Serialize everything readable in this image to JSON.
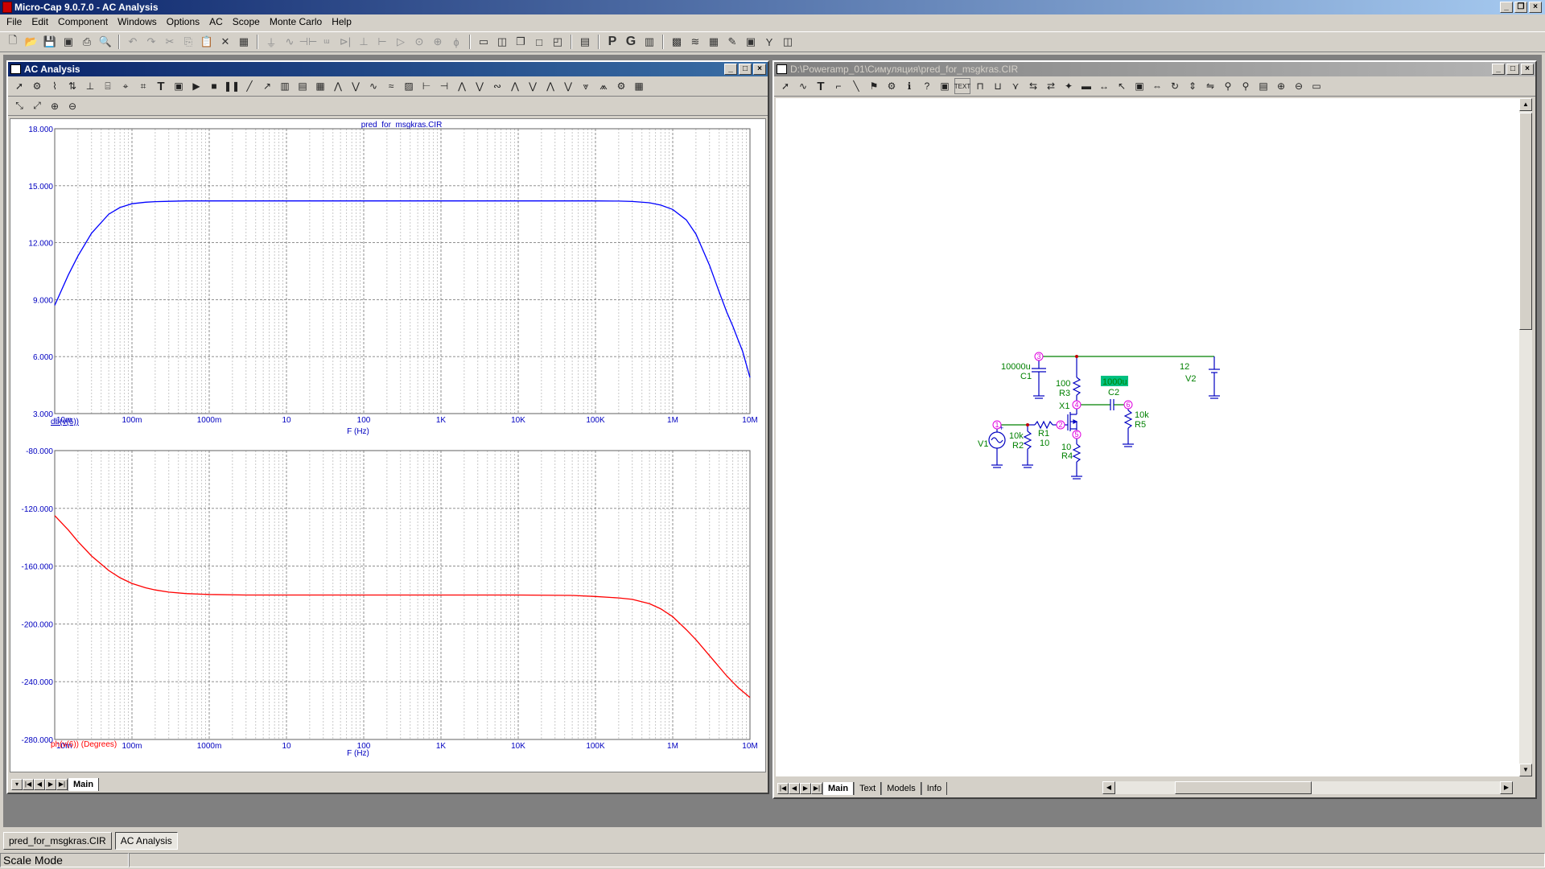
{
  "app": {
    "title": "Micro-Cap 9.0.7.0 - AC Analysis"
  },
  "menu": [
    "File",
    "Edit",
    "Component",
    "Windows",
    "Options",
    "AC",
    "Scope",
    "Monte Carlo",
    "Help"
  ],
  "toolbar": {
    "icons": [
      "new-file-icon",
      "open-icon",
      "save-icon",
      "save-all-icon",
      "print-icon",
      "print-preview-icon",
      "undo-icon",
      "redo-icon",
      "cut-icon",
      "copy-icon",
      "paste-icon",
      "delete-icon",
      "select-all-icon",
      "ground-icon",
      "resistor-icon",
      "capacitor-icon",
      "inductor-icon",
      "diode-icon",
      "battery-icon",
      "npn-icon",
      "opamp-icon",
      "source-icon",
      "tile-horizontal-icon",
      "tile-vertical-icon",
      "cascade-icon",
      "window-icon",
      "window2-icon",
      "calculator-icon",
      "p-icon",
      "g-icon",
      "component-icon",
      "matrix-icon",
      "waveform-icon",
      "probe-icon",
      "analysis-icon",
      "sub-icon",
      "help-icon"
    ],
    "p_label": "P",
    "g_label": "G"
  },
  "ac_window": {
    "title": "AC Analysis",
    "tabs": [
      "Main"
    ],
    "active_tab": "Main",
    "plot_title": "pred_for_msgkras.CIR"
  },
  "schematic_window": {
    "title": "D:\\Poweramp_01\\Симуляция\\pred_for_msgkras.CIR",
    "tabs": [
      "Main",
      "Text",
      "Models",
      "Info"
    ],
    "active_tab": "Main",
    "text_tool_label": "TEXT",
    "components": {
      "c1_value": "10000u",
      "c1_name": "C1",
      "r3_value": "100",
      "r3_name": "R3",
      "c2_value": "1000u",
      "c2_name": "C2",
      "v2_value": "12",
      "v2_name": "V2",
      "x1_name": "X1",
      "r1_name": "R1",
      "r1_value": "10",
      "r2_value": "10k",
      "r2_name": "R2",
      "v1_name": "V1",
      "r4_value": "10",
      "r4_name": "R4",
      "r5_value": "10k",
      "r5_name": "R5"
    },
    "nodes": [
      "1",
      "2",
      "3",
      "4",
      "5",
      "6"
    ]
  },
  "chart_data": [
    {
      "type": "line",
      "title": "pred_for_msgkras.CIR",
      "xlabel": "F (Hz)",
      "ylabel": "db(v(6))",
      "xscale": "log",
      "xlim": [
        0.01,
        10000000
      ],
      "ylim": [
        3,
        18
      ],
      "x_ticks": [
        "10m",
        "100m",
        "1000m",
        "10",
        "100",
        "1K",
        "10K",
        "100K",
        "1M",
        "10M"
      ],
      "y_ticks": [
        "18.000",
        "15.000",
        "12.000",
        "9.000",
        "6.000",
        "3.000"
      ],
      "grid": true,
      "series": [
        {
          "color": "#0000ff",
          "x": [
            0.01,
            0.015,
            0.02,
            0.03,
            0.05,
            0.07,
            0.1,
            0.15,
            0.2,
            0.3,
            0.5,
            1,
            10,
            100,
            1000,
            10000,
            100000,
            200000,
            300000,
            500000,
            700000,
            1000000,
            1500000,
            2000000,
            3000000,
            4000000,
            5000000,
            6000000,
            7000000,
            8000000,
            10000000
          ],
          "values": [
            8.7,
            10.3,
            11.3,
            12.5,
            13.5,
            13.85,
            14.05,
            14.13,
            14.16,
            14.18,
            14.2,
            14.2,
            14.2,
            14.2,
            14.2,
            14.2,
            14.2,
            14.19,
            14.17,
            14.1,
            13.98,
            13.75,
            13.2,
            12.45,
            10.8,
            9.4,
            8.35,
            7.6,
            6.9,
            6.3,
            4.9
          ]
        }
      ]
    },
    {
      "type": "line",
      "xlabel": "F (Hz)",
      "ylabel": "ph(v(6)) (Degrees)",
      "xscale": "log",
      "xlim": [
        0.01,
        10000000
      ],
      "ylim": [
        -280,
        -80
      ],
      "x_ticks": [
        "10m",
        "100m",
        "1000m",
        "10",
        "100",
        "1K",
        "10K",
        "100K",
        "1M",
        "10M"
      ],
      "y_ticks": [
        "-80.000",
        "-120.000",
        "-160.000",
        "-200.000",
        "-240.000",
        "-280.000"
      ],
      "grid": true,
      "series": [
        {
          "color": "#ff0000",
          "x": [
            0.01,
            0.015,
            0.02,
            0.03,
            0.05,
            0.07,
            0.1,
            0.15,
            0.2,
            0.3,
            0.5,
            1,
            3,
            10,
            100,
            1000,
            10000,
            50000,
            100000,
            200000,
            300000,
            500000,
            700000,
            1000000,
            1500000,
            2000000,
            3000000,
            5000000,
            7000000,
            10000000
          ],
          "values": [
            -125,
            -135,
            -143,
            -153,
            -163,
            -168,
            -172,
            -175,
            -176.5,
            -178,
            -179,
            -179.6,
            -180,
            -180,
            -180,
            -180,
            -180,
            -180.3,
            -181,
            -182,
            -183,
            -186,
            -189.5,
            -195,
            -204,
            -211,
            -222,
            -236,
            -244,
            -251
          ]
        }
      ]
    }
  ],
  "taskbar": [
    "pred_for_msgkras.CIR",
    "AC Analysis"
  ],
  "taskbar_active": "AC Analysis",
  "status": {
    "mode": "Scale Mode"
  }
}
